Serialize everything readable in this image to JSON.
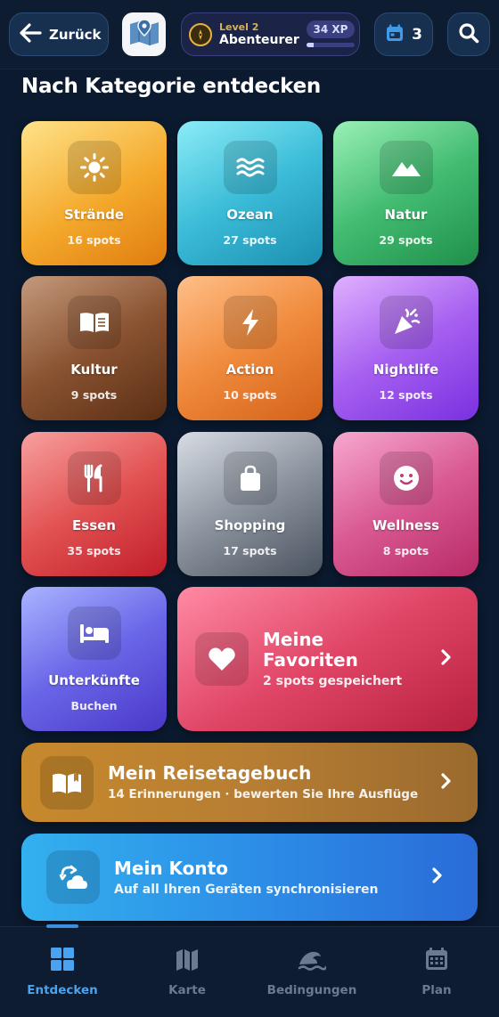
{
  "header": {
    "back_label": "Zurück",
    "level_label": "Level 2",
    "level_title": "Abenteurer",
    "xp_label": "34 XP",
    "xp_progress": 0.15,
    "plan_count": "3",
    "icons": [
      "arrow-left-icon",
      "map-logo-icon",
      "compass-icon",
      "calendar-icon",
      "search-icon"
    ]
  },
  "section": {
    "title": "Nach Kategorie entdecken"
  },
  "categories": [
    {
      "name": "Strände",
      "count": "16 spots",
      "icon": "sun-icon"
    },
    {
      "name": "Ozean",
      "count": "27 spots",
      "icon": "waves-icon"
    },
    {
      "name": "Natur",
      "count": "29 spots",
      "icon": "mountain-icon"
    },
    {
      "name": "Kultur",
      "count": "9 spots",
      "icon": "book-icon"
    },
    {
      "name": "Action",
      "count": "10 spots",
      "icon": "bolt-icon"
    },
    {
      "name": "Nightlife",
      "count": "12 spots",
      "icon": "party-popper-icon"
    },
    {
      "name": "Essen",
      "count": "35 spots",
      "icon": "utensils-icon"
    },
    {
      "name": "Shopping",
      "count": "17 spots",
      "icon": "shopping-bag-icon"
    },
    {
      "name": "Wellness",
      "count": "8 spots",
      "icon": "smile-icon"
    },
    {
      "name": "Unterkünfte",
      "count": "Buchen",
      "icon": "bed-icon"
    }
  ],
  "favorites": {
    "title": "Meine Favoriten",
    "subtitle": "2 spots gespeichert",
    "icon": "heart-icon"
  },
  "journal": {
    "title": "Mein Reisetagebuch",
    "subtitle": "14 Erinnerungen · bewerten Sie Ihre Ausflüge",
    "icon": "open-book-icon"
  },
  "account": {
    "title": "Mein Konto",
    "subtitle": "Auf all Ihren Geräten synchronisieren",
    "icon": "cloud-sync-icon"
  },
  "nav": [
    {
      "label": "Entdecken",
      "active": true,
      "icon": "grid-icon"
    },
    {
      "label": "Karte",
      "active": false,
      "icon": "map-icon"
    },
    {
      "label": "Bedingungen",
      "active": false,
      "icon": "wave-icon"
    },
    {
      "label": "Plan",
      "active": false,
      "icon": "calendar-icon"
    }
  ],
  "colors": {
    "background": "#0b1a2f",
    "accent": "#4aa3f0",
    "beaches": "#f0a32a",
    "ocean": "#2bb0d0",
    "nature": "#3fb06a",
    "culture": "#7a4a2e",
    "action": "#e8772a",
    "nightlife": "#9b57e8",
    "food": "#e04a4a",
    "shopping": "#6a7280",
    "wellness": "#d4487e",
    "stays": "#6a62e0",
    "favorites": "#e04566",
    "journal": "#c98a2c",
    "account": "#2f8ee8"
  }
}
